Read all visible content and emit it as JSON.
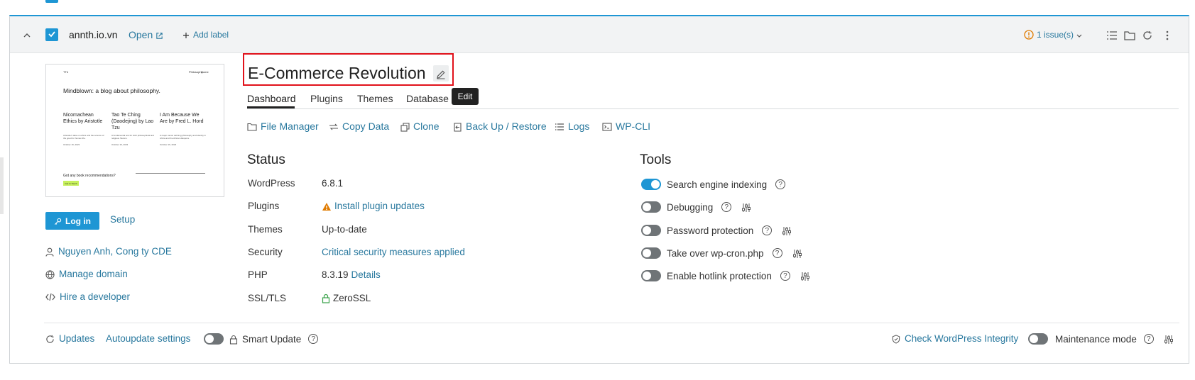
{
  "site": {
    "domain": "annth.io.vn",
    "open_label": "Open",
    "add_label": "Add label",
    "issues": "1 issue(s)",
    "title": "E-Commerce Revolution",
    "edit_tooltip": "Edit"
  },
  "preview": {
    "logo": "TT4",
    "nav_1": "Philosophy",
    "nav_2": "Home",
    "headline": "Mindblown: a blog about philosophy.",
    "post_1_title": "Nicomachean Ethics by Aristotle",
    "post_2_title": "Tao Te Ching (Daodejing) by Lao Tzu",
    "post_3_title": "I Am Because We Are by Fred L. Hord",
    "post_1_text": "Aristotle's take on ethics and the science of the good for human life.",
    "post_2_text": "A fundamental text for both philosophical and religious Taoism.",
    "post_3_text": "A major canon defining philosophy and identity in Africa and the African diaspora.",
    "post_1_date": "October 16, 2023",
    "post_2_date": "October 16, 2023",
    "post_3_date": "October 16, 2023",
    "cta": "Got any book recommendations?",
    "cta_button": "Get In Touch"
  },
  "sidebar": {
    "login_label": "Log in",
    "setup_label": "Setup",
    "owner": "Nguyen Anh, Cong ty CDE",
    "manage_domain": "Manage domain",
    "hire_dev": "Hire a developer"
  },
  "tabs": [
    "Dashboard",
    "Plugins",
    "Themes",
    "Database"
  ],
  "actions": [
    "File Manager",
    "Copy Data",
    "Clone",
    "Back Up / Restore",
    "Logs",
    "WP-CLI"
  ],
  "status": {
    "title": "Status",
    "rows": [
      {
        "label": "WordPress",
        "value": "6.8.1"
      },
      {
        "label": "Plugins",
        "value": "Install plugin updates"
      },
      {
        "label": "Themes",
        "value": "Up-to-date"
      },
      {
        "label": "Security",
        "value": "Critical security measures applied"
      },
      {
        "label": "PHP",
        "value": "8.3.19",
        "link": "Details"
      },
      {
        "label": "SSL/TLS",
        "value": "ZeroSSL"
      }
    ]
  },
  "tools": {
    "title": "Tools",
    "items": [
      {
        "label": "Search engine indexing",
        "on": true
      },
      {
        "label": "Debugging",
        "on": false
      },
      {
        "label": "Password protection",
        "on": false
      },
      {
        "label": "Take over wp-cron.php",
        "on": false
      },
      {
        "label": "Enable hotlink protection",
        "on": false
      }
    ]
  },
  "footer": {
    "updates": "Updates",
    "autoupdate": "Autoupdate settings",
    "smart_update": "Smart Update",
    "check_integrity": "Check WordPress Integrity",
    "maintenance": "Maintenance mode"
  },
  "colors": {
    "accent": "#1e96d4",
    "link": "#28789e",
    "warning": "#e07b00",
    "highlight_box": "#e1111a",
    "success": "#3aa24a"
  }
}
